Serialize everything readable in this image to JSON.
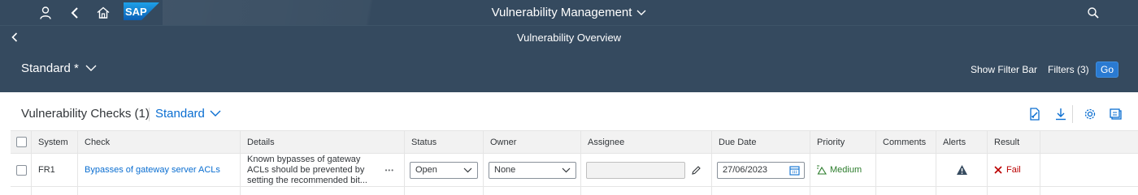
{
  "shell": {
    "logo_text": "SAP",
    "app_title": "Vulnerability Management",
    "icons": [
      "user-icon",
      "back-icon",
      "home-icon",
      "search-icon"
    ]
  },
  "subheader": {
    "title": "Vulnerability Overview"
  },
  "filterbar": {
    "variant": "Standard *",
    "show_filter_bar": "Show Filter Bar",
    "filters": "Filters (3)",
    "go": "Go"
  },
  "table": {
    "title": "Vulnerability Checks (1)",
    "variant": "Standard",
    "columns": [
      "System",
      "Check",
      "Details",
      "Status",
      "Owner",
      "Assignee",
      "Due Date",
      "Priority",
      "Comments",
      "Alerts",
      "Result"
    ],
    "rows": [
      {
        "system": "FR1",
        "check": "Bypasses of gateway server ACLs",
        "details_line1": "Known bypasses of gateway",
        "details_line2": "ACLs should be prevented by",
        "details_line3": "setting the recommended bit...",
        "more": "•••",
        "status": "Open",
        "owner": "None",
        "assignee": "",
        "due_date": "27/06/2023",
        "priority": "Medium",
        "comments": "",
        "result": "Fail"
      }
    ]
  },
  "colors": {
    "shell_bg": "#354a5f",
    "link": "#0a6ed1",
    "priority_medium": "#2b7c2b",
    "fail": "#bb0000",
    "go_button": "#2a7ad1"
  }
}
